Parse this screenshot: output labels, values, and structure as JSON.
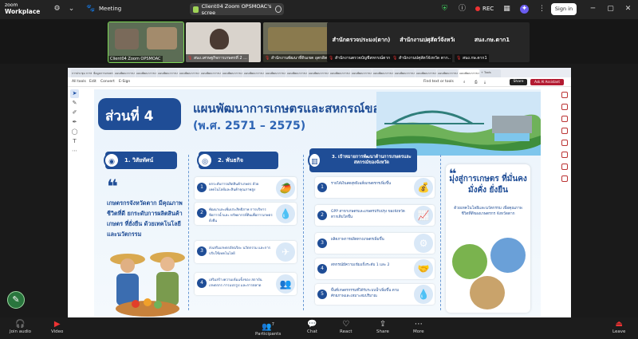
{
  "app": {
    "logo_line1": "zoom",
    "logo_line2": "Workplace",
    "meeting_label": "Meeting",
    "share_title": "Client04 Zoom OPSMOAC's scree",
    "rec_label": "REC",
    "signin_label": "Sign in"
  },
  "participants": [
    {
      "name": "Client04 Zoom OPSMOAC",
      "big": ""
    },
    {
      "name": "สนง.เศรษฐกิจการเกษตรที่ 2 ...",
      "big": ""
    },
    {
      "name": "สำนักงานพัฒนาที่ดินเขต อุตรดิตถ์ 8...",
      "big": ""
    },
    {
      "name": "สำนักงานตรวจบัญชีสหกรณ์ตาก ncp",
      "big": "สำนักตรวจประมง(ตาก)..."
    },
    {
      "name": "สำนักงานปศุสัตว์จังหวัด ตาก..",
      "big": "สำนักงานปศุสัตว์จังหวัด"
    },
    {
      "name": "สนง.กษ.ตาก1",
      "big": "สนง.กษ.ตาก1"
    }
  ],
  "browser": {
    "tabs": [
      "การประชุม การพัฒนาสะอาด...",
      "ข้อมูลการเกษตร",
      "แผนพัฒนาการเกษตร...",
      "แผนพัฒนาการเกษตร...",
      "แผนพัฒนาการเกษตร...",
      "แผนพัฒนาการเกษตร...",
      "แผนพัฒนาการเกษตร...",
      "แผนพัฒนาการเกษตร...",
      "แผนพัฒนาการเกษตร...",
      "แผนพัฒนาการเกษตร...",
      "แผนพัฒนาการเกษตร...",
      "แผนพัฒนาการเกษตร...",
      "แผนพัฒนาการเกษตร...",
      "แผนพัฒนาการเกษตร...",
      "แผนพัฒนาการเกษตร...",
      "แผนพัฒนาการเกษตร...",
      "แผนพัฒนาการเกษตร...",
      "แผนพัฒนาการเกษตร...",
      "แผนพัฒนาการเกษตร..."
    ],
    "new_tab": "+ Tools",
    "toolbar_items": [
      "All tools",
      "Edit",
      "Convert",
      "E-Sign"
    ],
    "find_label": "Find text or tools",
    "share_label": "Share",
    "ai_label": "Ask AI Assistant"
  },
  "slide": {
    "part": "ส่วนที่ 4",
    "title": "แผนพัฒนาการเกษตรและสหกรณ์ของจังหวัด",
    "subtitle": "(พ.ศ. 2571 – 2575)",
    "vision_head": "1. วิสัยทัศน์",
    "mission_head": "2. พันธกิจ",
    "goal_head": "3. เป้าหมายการพัฒนาด้านการเกษตรและสหกรณ์ของจังหวัด",
    "vision_text": "เกษตรกรจังหวัดตาก มีคุณภาพชีวิตที่ดี ยกระดับการผลิตสินค้าเกษตร ที่ยั่งยืน ด้วยเทคโนโลยี และนวัตกรรม",
    "missions": [
      {
        "n": "1",
        "text": "ยกระดับการผลิตสินค้าเกษตร ด้วยเทคโนโลยีและสินค้าคุณภาพสูง",
        "icon": "durian-icon"
      },
      {
        "n": "2",
        "text": "พัฒนาและเพิ่มประสิทธิภาพ การบริหารจัดการน้ำและ ทรัพยากรที่ดินเพื่อการเกษตรยั่งยืน",
        "icon": "water-drop-icon"
      },
      {
        "n": "3",
        "text": "ส่งเสริมเกษตรอัจฉริยะ นวัตกรรม และการปรับใช้เทคโนโลยี",
        "icon": "drone-icon"
      },
      {
        "n": "4",
        "text": "เสริมสร้างความเข้มแข็งของ สถาบันเกษตรกร การแปรรูป และการตลาด",
        "icon": "people-icon"
      }
    ],
    "goals": [
      {
        "n": "1",
        "text": "รายได้เงินสดสุทธิเฉลี่ยเกษตรกรเพิ่มขึ้น",
        "icon": "money-icon"
      },
      {
        "n": "2",
        "text": "GPP สาขาเกษตรและเกษตรปรับปรุง ของจังหวัดตากเติบโตขึ้น",
        "icon": "chart-icon"
      },
      {
        "n": "3",
        "text": "ผลิตภาพการผลิตทางเกษตรเพิ่มขึ้น",
        "icon": "gear-icon"
      },
      {
        "n": "4",
        "text": "สหกรณ์มีความเข้มแข็งระดับ 1 และ 2",
        "icon": "handshake-icon"
      },
      {
        "n": "5",
        "text": "พื้นที่เกษตรกรรมที่ได้รับระบบน้ำเพิ่มขึ้น ตามศักยภาพและเหมาะสมปริมาณ",
        "icon": "drop-icon"
      }
    ],
    "aim_title": "มุ่งสู่การเกษตร ที่มั่นคง มั่งคั่ง ยั่งยืน",
    "aim_sub": "ด้วยเทคโนโลยีและนวัตกรรม เพื่อคุณภาพชีวิตที่ดีของเกษตรกร จังหวัดตาก"
  },
  "bottombar": {
    "join_audio": "Join audio",
    "video": "Video",
    "participants": "Participants",
    "participants_count": "7",
    "chat": "Chat",
    "react": "React",
    "share": "Share",
    "more": "More",
    "leave": "Leave"
  },
  "colors": {
    "brand": "#1f4d96",
    "accent_green": "#7ed957",
    "danger": "#e33333"
  }
}
